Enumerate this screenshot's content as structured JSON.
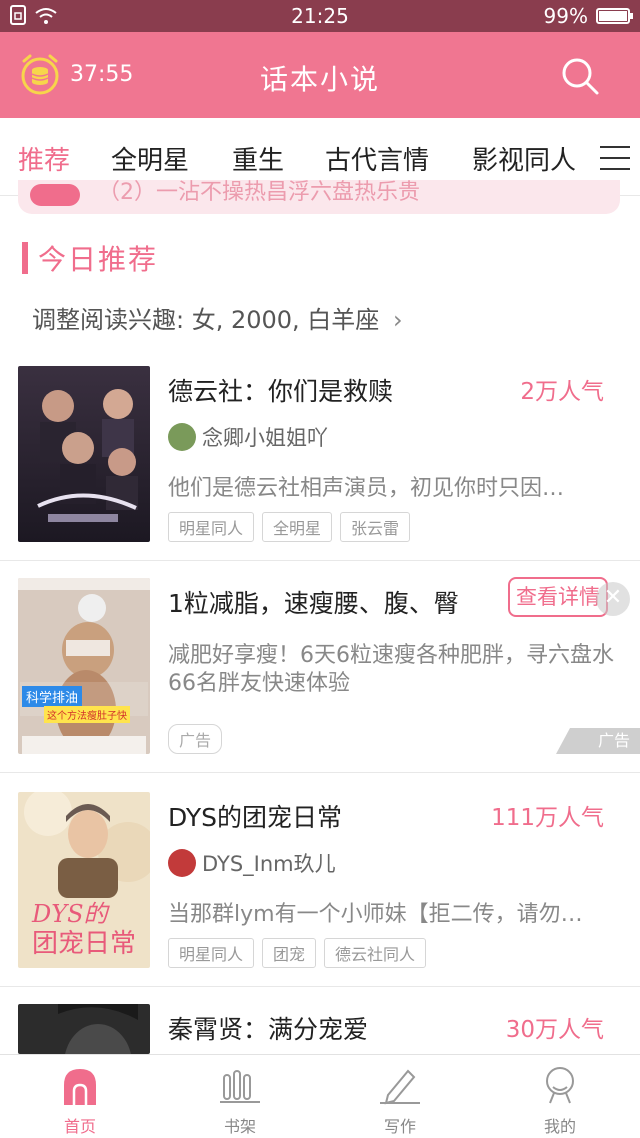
{
  "status_bar": {
    "time": "21:25",
    "battery": "99%",
    "battery_level": 0.99
  },
  "header": {
    "timer": "37:55",
    "title": "话本小说"
  },
  "tabs": [
    {
      "label": "推荐",
      "active": true
    },
    {
      "label": "全明星"
    },
    {
      "label": "重生"
    },
    {
      "label": "古代言情"
    },
    {
      "label": "影视同人"
    }
  ],
  "banner": {
    "text": "（2）一沾不操热昌浮六盘热乐贵"
  },
  "section": {
    "title": "今日推荐",
    "prefs": "调整阅读兴趣: 女, 2000, 白羊座",
    "prefs_arrow": "›"
  },
  "items": [
    {
      "title": "德云社：你们是救赎",
      "popularity": "2万人气",
      "author": "念卿小姐姐吖",
      "desc": "他们是德云社相声演员，初见你时只因…",
      "tags": [
        "明星同人",
        "全明星",
        "张云雷"
      ]
    },
    {
      "title": "DYS的团宠日常",
      "popularity": "111万人气",
      "author": "DYS_Inm玖儿",
      "desc": "当那群lym有一个小师妹【拒二传，请勿…",
      "tags": [
        "明星同人",
        "团宠",
        "德云社同人"
      ]
    },
    {
      "title": "秦霄贤：满分宠爱",
      "popularity": "30万人气"
    }
  ],
  "ad": {
    "title": "1粒减脂，速瘦腰、腹、臀",
    "detail_button": "查看详情",
    "close": "✕",
    "desc": "减肥好享瘦！6天6粒速瘦各种肥胖，寻六盘水66名胖友快速体验",
    "tag": "广告",
    "corner": "广告",
    "cover_caption_1": "科学排油",
    "cover_caption_2": "这个方法瘦肚子快"
  },
  "bottom_nav": [
    {
      "label": "首页",
      "active": true
    },
    {
      "label": "书架"
    },
    {
      "label": "写作"
    },
    {
      "label": "我的"
    }
  ],
  "colors": {
    "accent": "#f06d8c",
    "header_bg": "#f07691",
    "statusbar_bg": "#8a3d4e"
  }
}
